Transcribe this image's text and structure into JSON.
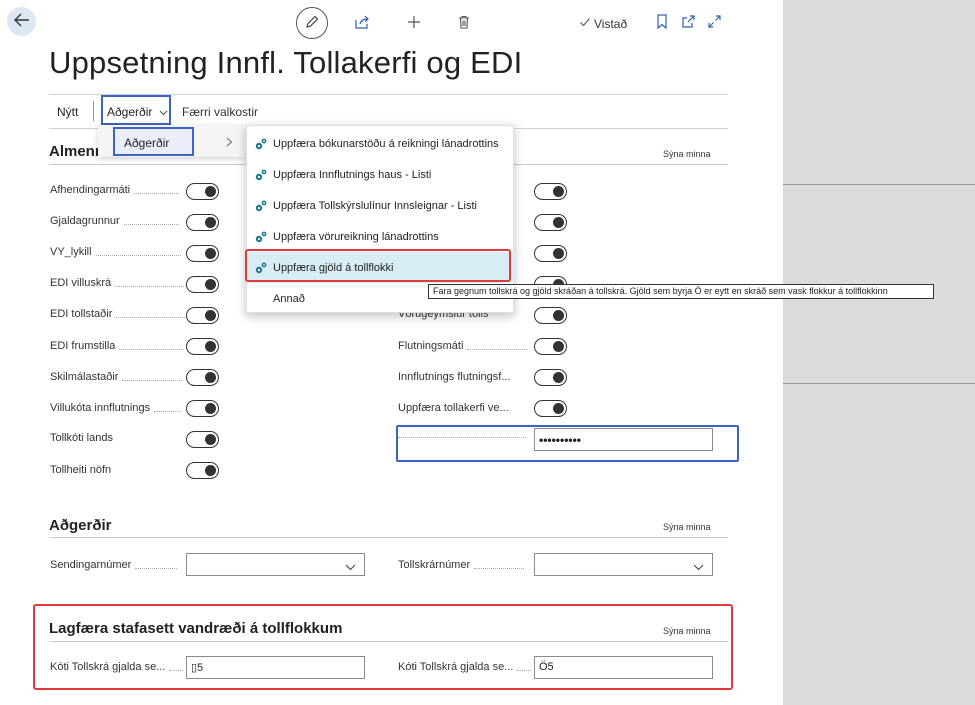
{
  "header": {
    "title": "Uppsetning Innfl. Tollakerfi og EDI",
    "saved_label": "Vistað"
  },
  "actionbar": {
    "new_label": "Nýtt",
    "actions_label": "Aðgerðir",
    "fewer_options_label": "Færri valkostir"
  },
  "submenu": {
    "label": "Aðgerðir"
  },
  "dropdown": {
    "items": [
      "Uppfæra bókunarstöðu á reikningi lánadrottins",
      "Uppfæra Innflutnings haus - Listi",
      "Uppfæra Tollskýrslulínur Innsleignar - Listi",
      "Uppfæra vörureikning lánadrottins",
      "Uppfæra gjöld á tollflokki"
    ],
    "other_label": "Annað",
    "tooltip": "Fara gegnum tollskrá og gjöld skráðan á tollskrá.  Gjöld sem byrja Ö er eytt en skráð sem vask flokkur á tollflokkinn"
  },
  "general": {
    "title": "Almenn",
    "show_less": "Sýna minna",
    "left_fields": [
      "Afhendingarmáti",
      "Gjaldagrunnur",
      "VY_lykill",
      "EDI villuskrá",
      "EDI tollstaðir",
      "EDI frumstilla",
      "Skilmálastaðir",
      "Villukóta innflutnings",
      "Tollkóti lands",
      "Tollheiti nöfn"
    ],
    "right_fields": [
      "Vörugeymslur tolls",
      "Flutningsmáti",
      "Innflutnings flutningsf...",
      "Uppfæra tollakerfi ve..."
    ],
    "password_value": "••••••••••"
  },
  "actions_section": {
    "title": "Aðgerðir",
    "show_less": "Sýna minna",
    "field1_label": "Sendingarnúmer",
    "field2_label": "Tollskrárnúmer"
  },
  "fix_section": {
    "title": "Lagfæra stafasett vandræði á tollflokkum",
    "show_less": "Sýna minna",
    "field1_label": "Kóti Tollskrá gjalda se...",
    "field1_value": "▯5",
    "field2_label": "Kóti Tollskrá gjalda se...",
    "field2_value": "Ö5"
  },
  "colors": {
    "highlight_blue": "#3b63c4",
    "highlight_red": "#e03a3a",
    "menu_active_bg": "#d7edf3",
    "icon_teal": "#1f7a8c"
  }
}
